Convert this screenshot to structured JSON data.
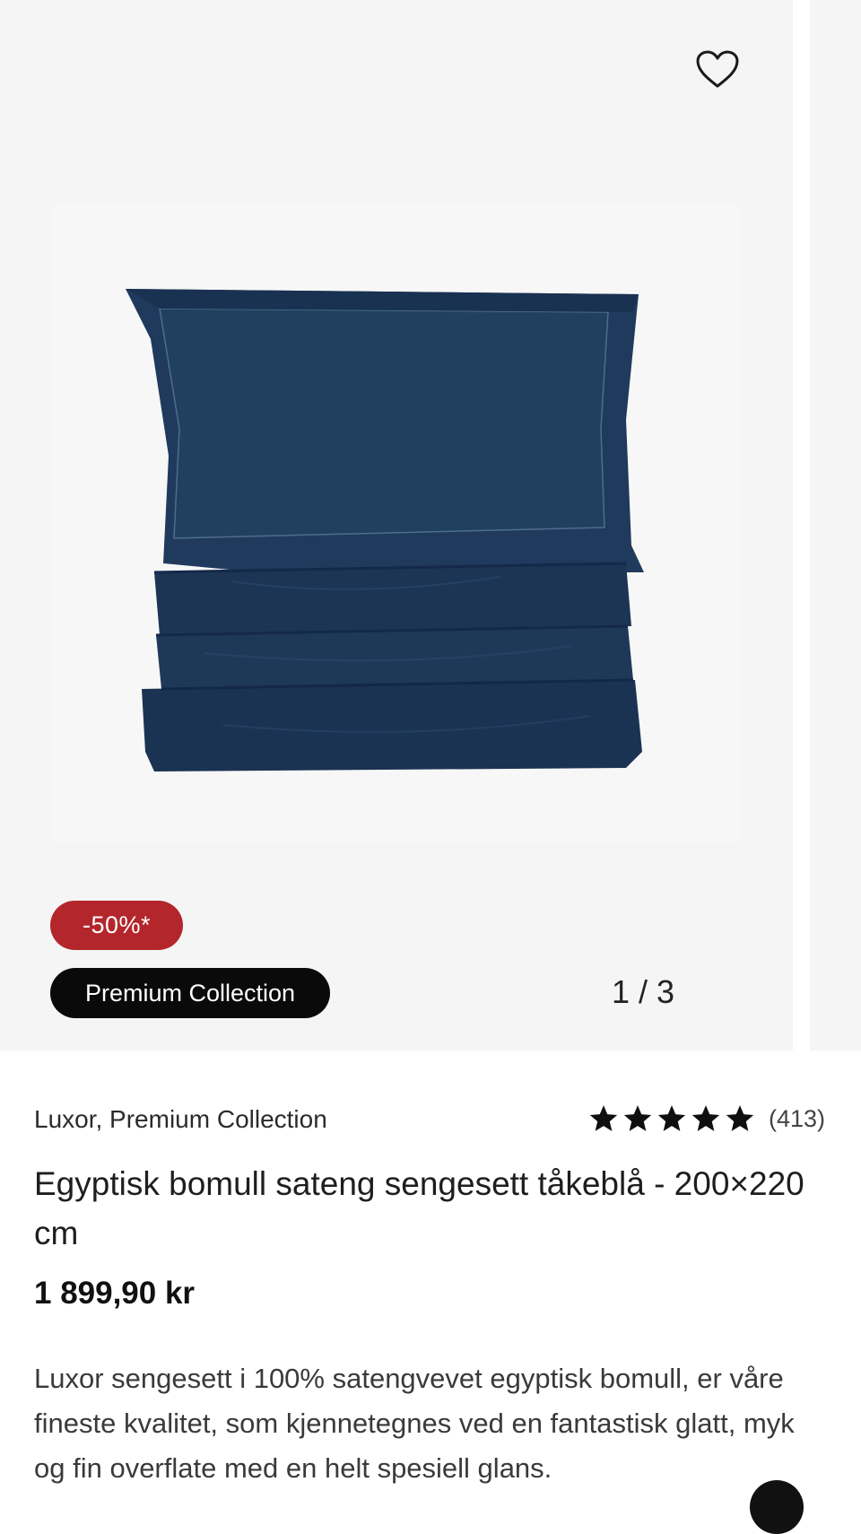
{
  "gallery": {
    "discount_badge": "-50%*",
    "collection_badge": "Premium Collection",
    "slide_counter": "1 / 3",
    "image_alt": "Egyptisk bomull sateng sengesett tåkeblå"
  },
  "product": {
    "brand_line": "Luxor, Premium Collection",
    "rating_stars": 5,
    "rating_count": "(413)",
    "title": "Egyptisk bomull sateng sengesett tåkeblå - 200×220 cm",
    "price": "1 899,90 kr",
    "description": "Luxor sengesett i 100% satengvevet egyptisk bomull, er våre fineste kvalitet, som kjennetegnes ved en fantastisk glatt, myk og fin overflate med en helt spesiell glans."
  },
  "icons": {
    "wishlist": "heart-outline-icon",
    "star": "star-filled-icon"
  },
  "colors": {
    "discount_badge_bg": "#b3262b",
    "collection_badge_bg": "#0a0a0a",
    "product_navy": "#1d3553",
    "gallery_bg": "#f5f5f5"
  }
}
